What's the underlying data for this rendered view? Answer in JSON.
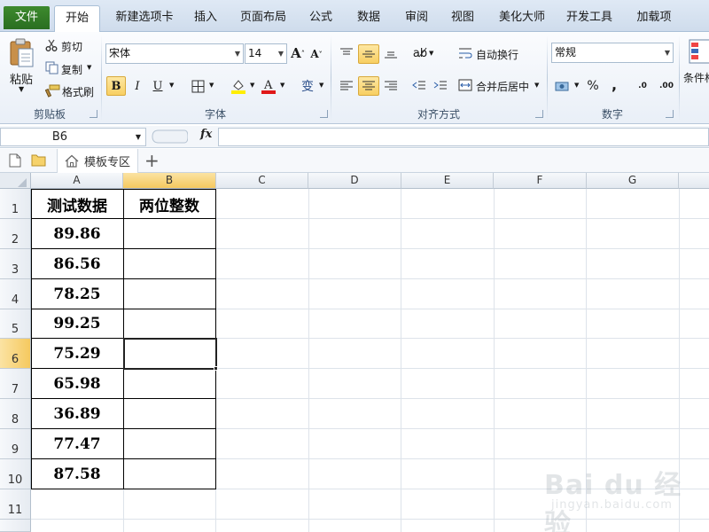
{
  "tabs": [
    {
      "label": "文件"
    },
    {
      "label": "开始"
    },
    {
      "label": "新建选项卡"
    },
    {
      "label": "插入"
    },
    {
      "label": "页面布局"
    },
    {
      "label": "公式"
    },
    {
      "label": "数据"
    },
    {
      "label": "审阅"
    },
    {
      "label": "视图"
    },
    {
      "label": "美化大师"
    },
    {
      "label": "开发工具"
    },
    {
      "label": "加载项"
    }
  ],
  "ribbon": {
    "clipboard": {
      "paste": "粘贴",
      "cut": "剪切",
      "copy": "复制",
      "format_painter": "格式刷",
      "label": "剪贴板"
    },
    "font": {
      "name": "宋体",
      "size": "14",
      "bold": "B",
      "italic": "I",
      "underline": "U",
      "label": "字体",
      "wen": "变"
    },
    "alignment": {
      "wrap": "自动换行",
      "merge": "合并后居中",
      "label": "对齐方式"
    },
    "number": {
      "format": "常规",
      "percent": "%",
      "comma": ",",
      "inc": ".0",
      "dec": ".00",
      "label": "数字"
    },
    "styles": {
      "cond": "条件格"
    }
  },
  "formula_bar": {
    "name_box": "B6",
    "fx": "fx",
    "value": ""
  },
  "quick_bar": {
    "template_tab": "模板专区",
    "plus": "+"
  },
  "columns": [
    "A",
    "B",
    "C",
    "D",
    "E",
    "F",
    "G"
  ],
  "rows": [
    "1",
    "2",
    "3",
    "4",
    "5",
    "6",
    "7",
    "8",
    "9",
    "10",
    "11"
  ],
  "sheet": {
    "header_a": "测试数据",
    "header_b": "两位整数",
    "values": [
      "89.86",
      "86.56",
      "78.25",
      "99.25",
      "75.29",
      "65.98",
      "36.89",
      "77.47",
      "87.58"
    ]
  },
  "watermark": {
    "text": "Bai du 经验",
    "sub": "jingyan.baidu.com"
  },
  "colors": {
    "accent": "#2a6e20",
    "selected_header": "#f5c95f",
    "pressed": "#f8cf62"
  }
}
